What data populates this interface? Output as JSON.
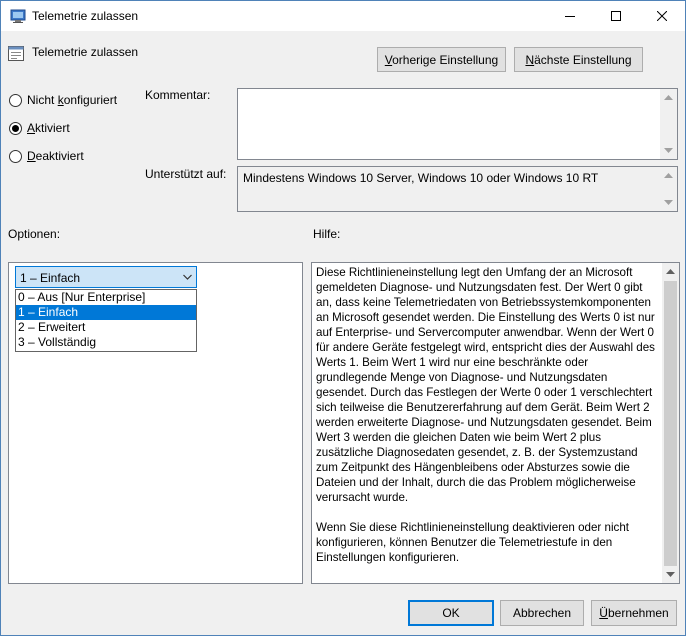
{
  "window": {
    "title": "Telemetrie zulassen",
    "header_title": "Telemetrie zulassen"
  },
  "nav": {
    "prev_label_u": "V",
    "prev_label_rest": "orherige Einstellung",
    "next_label_u": "N",
    "next_label_rest": "ächste Einstellung"
  },
  "state": {
    "options": [
      {
        "pre": "Nicht ",
        "u": "k",
        "post": "onfiguriert",
        "selected": false
      },
      {
        "pre": "",
        "u": "A",
        "post": "ktiviert",
        "selected": true
      },
      {
        "pre": "",
        "u": "D",
        "post": "eaktiviert",
        "selected": false
      }
    ]
  },
  "comment": {
    "label": "Kommentar:",
    "value": ""
  },
  "supported": {
    "label": "Unterstützt auf:",
    "value": "Mindestens Windows 10 Server, Windows 10 oder Windows 10 RT"
  },
  "options_panel": {
    "label": "Optionen:",
    "combo_value": "1 – Einfach",
    "items": [
      "0 – Aus [Nur Enterprise]",
      "1 – Einfach",
      "2 – Erweitert",
      "3 – Vollständig"
    ],
    "selected_index": 1
  },
  "help": {
    "label": "Hilfe:",
    "paragraph1": "Diese Richtlinieneinstellung legt den Umfang der an Microsoft gemeldeten Diagnose- und Nutzungsdaten fest. Der Wert 0 gibt an, dass keine Telemetriedaten von Betriebssystemkomponenten an Microsoft gesendet werden. Die Einstellung des Werts 0 ist nur auf Enterprise- und Servercomputer anwendbar. Wenn der Wert 0 für andere Geräte festgelegt wird, entspricht dies der Auswahl des Werts 1. Beim Wert 1 wird nur eine beschränkte oder grundlegende Menge von Diagnose- und Nutzungsdaten gesendet. Durch das Festlegen der Werte 0 oder 1 verschlechtert sich teilweise die Benutzererfahrung auf dem Gerät. Beim Wert 2 werden erweiterte Diagnose- und Nutzungsdaten gesendet. Beim Wert 3 werden die gleichen Daten wie beim Wert 2 plus zusätzliche Diagnosedaten gesendet, z. B. der Systemzustand zum Zeitpunkt des Hängenbleibens oder Absturzes sowie die Dateien und der Inhalt, durch die das Problem möglicherweise verursacht wurde.",
    "paragraph2": "Wenn Sie diese Richtlinieneinstellung deaktivieren oder nicht konfigurieren, können Benutzer die Telemetriestufe in den Einstellungen konfigurieren."
  },
  "footer": {
    "ok": "OK",
    "cancel": "Abbrechen",
    "apply_u": "Ü",
    "apply_rest": "bernehmen"
  },
  "colors": {
    "accent": "#0078d7",
    "face": "#f0f0f0",
    "border": "#828790"
  },
  "icons": {
    "title": "policy-window-icon",
    "header": "policy-setting-icon"
  }
}
